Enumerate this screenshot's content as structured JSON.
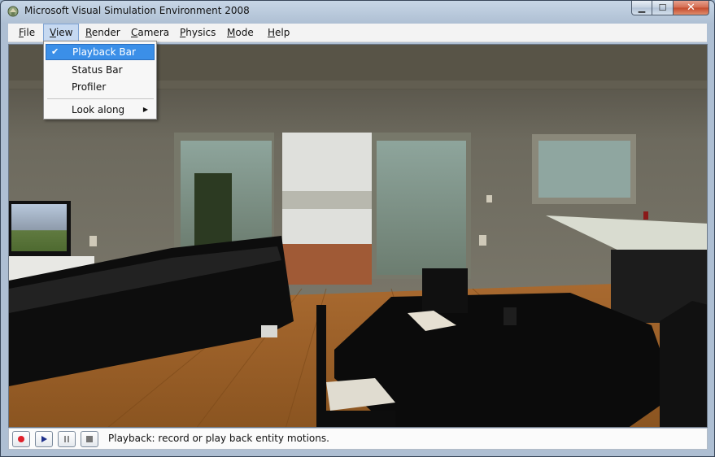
{
  "window": {
    "title": "Microsoft Visual Simulation Environment 2008",
    "buttons": {
      "minimize_icon": "minimize-icon",
      "maximize_icon": "maximize-icon",
      "close_icon": "close-icon",
      "close_glyph": "✕"
    }
  },
  "menubar": {
    "items": [
      {
        "label": "File",
        "accel": "F"
      },
      {
        "label": "View",
        "accel": "V"
      },
      {
        "label": "Render",
        "accel": "R"
      },
      {
        "label": "Camera",
        "accel": "C"
      },
      {
        "label": "Physics",
        "accel": "P"
      },
      {
        "label": "Mode",
        "accel": "M"
      },
      {
        "label": "Help",
        "accel": "H"
      }
    ],
    "active": "View"
  },
  "view_menu": {
    "items": [
      {
        "label": "Playback Bar",
        "checked": true,
        "highlighted": true
      },
      {
        "label": "Status Bar",
        "checked": false
      },
      {
        "label": "Profiler",
        "checked": false
      },
      {
        "label": "Look along",
        "submenu": true
      }
    ],
    "check_glyph": "✔",
    "submenu_glyph": "▶"
  },
  "playback": {
    "buttons": [
      "record-button",
      "play-button",
      "pause-button",
      "stop-button"
    ],
    "status": "Playback: record or play back entity motions."
  },
  "colors": {
    "record": "#e0202a",
    "play": "#1d2f8a",
    "menu_highlight": "#3b8fe8"
  }
}
